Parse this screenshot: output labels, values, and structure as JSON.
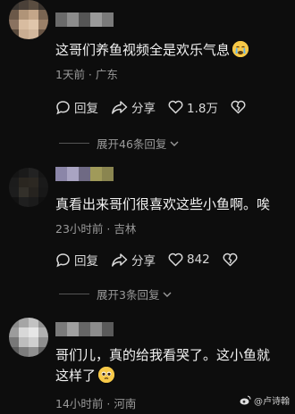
{
  "comments": [
    {
      "text": "这哥们养鱼视频全是欢乐气息",
      "emoji": "crying-face",
      "meta": "1天前 · 广东",
      "reply_label": "回复",
      "share_label": "分享",
      "like_count": "1.8万",
      "expand_label": "展开46条回复"
    },
    {
      "text": "真看出来哥们很喜欢这些小鱼啊。唉",
      "meta": "23小时前 · 吉林",
      "reply_label": "回复",
      "share_label": "分享",
      "like_count": "842",
      "expand_label": "展开3条回复"
    },
    {
      "text_line1": "哥们儿，真的给我看哭了。这小鱼就",
      "text_line2": "这样了",
      "emoji": "pleading-face",
      "meta": "14小时前 · 河南"
    }
  ],
  "watermark": "@卢诗翰",
  "colors": {
    "background": "#0d0d0d",
    "text": "#f2f2f2",
    "meta": "#9a9a9a"
  }
}
